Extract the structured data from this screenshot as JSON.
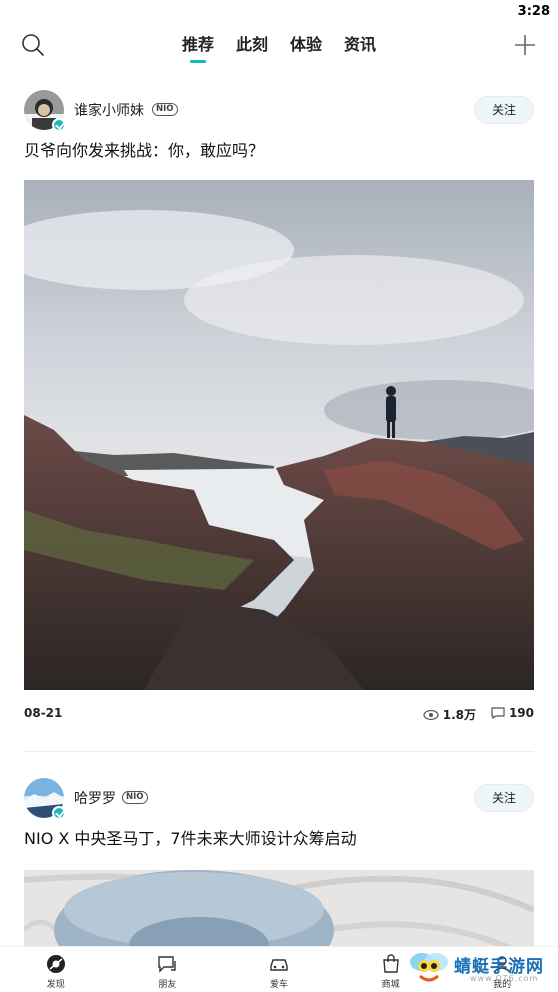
{
  "status_bar": {
    "time": "3:28"
  },
  "top_nav": {
    "tabs": [
      {
        "label": "推荐",
        "active": true
      },
      {
        "label": "此刻",
        "active": false
      },
      {
        "label": "体验",
        "active": false
      },
      {
        "label": "资讯",
        "active": false
      }
    ],
    "accent_color": "#15b6c0"
  },
  "posts": [
    {
      "author": "谁家小师妹",
      "badge": "NIO",
      "follow_label": "关注",
      "title": "贝爷向你发来挑战：你，敢应吗？",
      "date": "08-21",
      "views": "1.8万",
      "comments": "190"
    },
    {
      "author": "哈罗罗",
      "badge": "NIO",
      "follow_label": "关注",
      "title": "NIO X 中央圣马丁，7件未来大师设计众筹启动"
    }
  ],
  "bottom_nav": {
    "items": [
      {
        "label": "发现",
        "icon": "discover-icon"
      },
      {
        "label": "朋友",
        "icon": "chat-icon"
      },
      {
        "label": "爱车",
        "icon": "car-icon"
      },
      {
        "label": "商城",
        "icon": "shopping-bag-icon"
      },
      {
        "label": "我的",
        "icon": "profile-icon"
      }
    ]
  },
  "watermark": {
    "text": "蜻蜓手游网",
    "url": "www.QT6.com"
  }
}
